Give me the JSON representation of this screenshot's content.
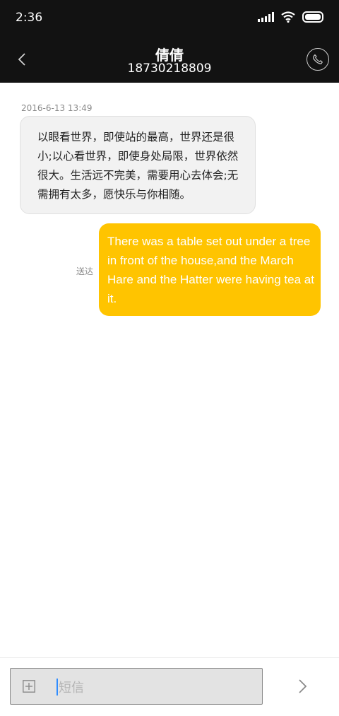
{
  "status_bar": {
    "time": "2:36",
    "icons": [
      "signal-icon",
      "wifi-icon",
      "battery-icon"
    ]
  },
  "header": {
    "contact_name": "倩倩",
    "contact_number": "18730218809",
    "back_icon": "chevron-left-icon",
    "call_icon": "phone-icon"
  },
  "conversation": {
    "timestamp": "2016-6-13 13:49",
    "messages": [
      {
        "direction": "incoming",
        "text": "以眼看世界，即使站的最高，世界还是很小;以心看世界，即使身处局限，世界依然很大。生活远不完美，需要用心去体会;无需拥有太多，愿快乐与你相随。"
      },
      {
        "direction": "outgoing",
        "text": "There was a table set out under a tree in front of the house,and the March Hare and the Hatter were having tea at it.",
        "status": "送达"
      }
    ]
  },
  "composer": {
    "placeholder": "短信",
    "value": "",
    "attach_icon": "plus-square-icon",
    "send_icon": "chevron-right-icon"
  },
  "colors": {
    "header_bg": "#121212",
    "outgoing_bubble": "#ffc400",
    "incoming_bubble": "#f2f2f2",
    "cursor": "#2f8cff"
  }
}
